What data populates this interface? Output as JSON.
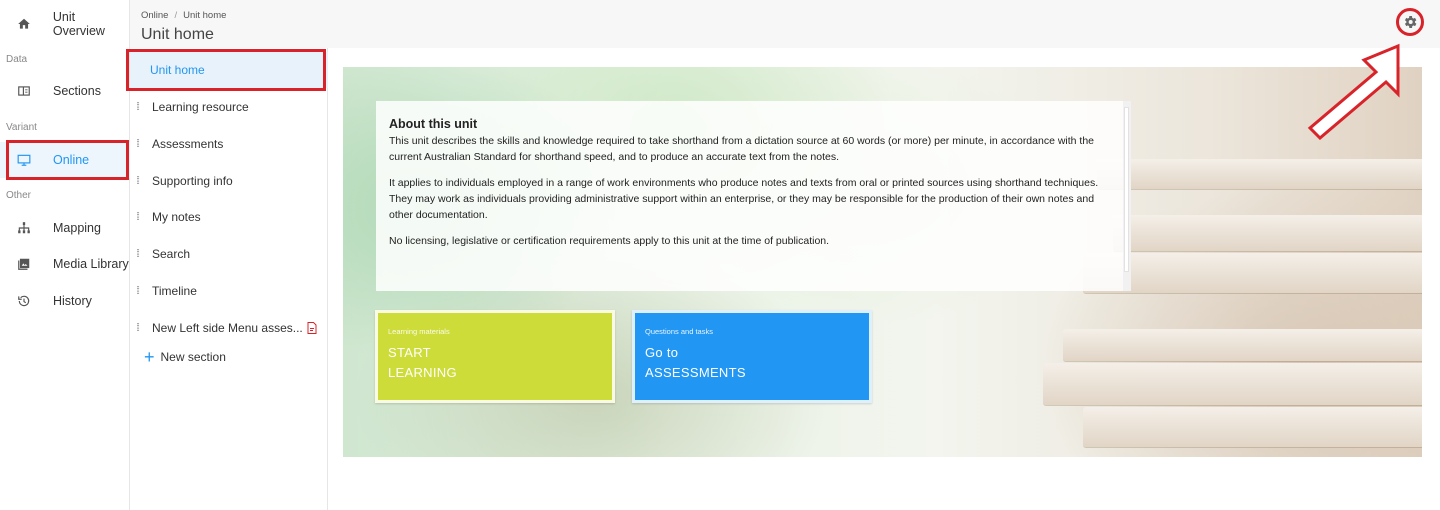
{
  "breadcrumb": {
    "items": [
      "Online",
      "Unit home"
    ]
  },
  "header": {
    "title": "Unit home"
  },
  "leftnav": {
    "top_item": {
      "label": "Unit Overview",
      "icon": "home-icon"
    },
    "sections": [
      {
        "label": "Data",
        "items": [
          {
            "label": "Sections",
            "icon": "sections-icon"
          }
        ]
      },
      {
        "label": "Variant",
        "items": [
          {
            "label": "Online",
            "icon": "monitor-icon",
            "active": true
          }
        ]
      },
      {
        "label": "Other",
        "items": [
          {
            "label": "Mapping",
            "icon": "sitemap-icon"
          },
          {
            "label": "Media Library",
            "icon": "media-library-icon"
          },
          {
            "label": "History",
            "icon": "history-icon"
          }
        ]
      }
    ]
  },
  "subnav": {
    "items": [
      {
        "label": "Unit home",
        "active": true
      },
      {
        "label": "Learning resource"
      },
      {
        "label": "Assessments"
      },
      {
        "label": "Supporting info"
      },
      {
        "label": "My notes"
      },
      {
        "label": "Search"
      },
      {
        "label": "Timeline"
      },
      {
        "label": "New Left side Menu asses...",
        "icon": "document-icon"
      }
    ],
    "add_label": "New section"
  },
  "about": {
    "title": "About this unit",
    "paragraphs": [
      "This unit describes the skills and knowledge required to take shorthand from a dictation source at 60 words (or more) per minute, in accordance with the current Australian Standard for shorthand speed, and to produce an accurate text from the notes.",
      "It applies to individuals employed in a range of work environments who produce notes and texts from oral or printed sources using shorthand techniques. They may work as individuals providing administrative support within an enterprise, or they may be responsible for the production of their own notes and other documentation.",
      "No licensing, legislative or certification requirements apply to this unit at the time of publication."
    ]
  },
  "cta": {
    "learning": {
      "small": "Learning materials",
      "line1": "START",
      "line2": "LEARNING",
      "color": "#cddc39"
    },
    "assessments": {
      "small": "Questions and tasks",
      "line1": "Go to",
      "line2": "ASSESSMENTS",
      "color": "#2196f3"
    }
  },
  "colors": {
    "accent": "#2196f3",
    "highlight": "#d8232a"
  }
}
